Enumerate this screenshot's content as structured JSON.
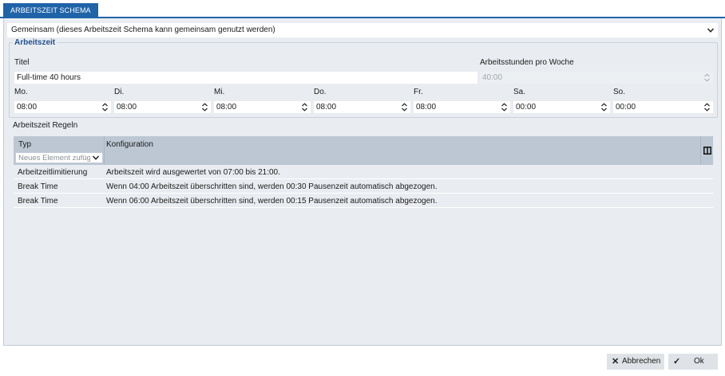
{
  "tab": {
    "label": "ARBEITSZEIT SCHEMA"
  },
  "scope_select": {
    "value": "Gemeinsam (dieses Arbeitszeit Schema kann gemeinsam genutzt werden)"
  },
  "arbeitszeit": {
    "legend": "Arbeitszeit",
    "titel_label": "Titel",
    "titel_value": "Full-time 40 hours",
    "stunden_label": "Arbeitsstunden pro Woche",
    "stunden_value": "40:00",
    "days": [
      {
        "label": "Mo.",
        "value": "08:00"
      },
      {
        "label": "Di.",
        "value": "08:00"
      },
      {
        "label": "Mi.",
        "value": "08:00"
      },
      {
        "label": "Do.",
        "value": "08:00"
      },
      {
        "label": "Fr.",
        "value": "08:00"
      },
      {
        "label": "Sa.",
        "value": "00:00"
      },
      {
        "label": "So.",
        "value": "00:00"
      }
    ]
  },
  "regeln": {
    "title": "Arbeitszeit Regeln",
    "col_typ": "Typ",
    "col_konfiguration": "Konfiguration",
    "add_placeholder": "Neues Element zufügen",
    "rows": [
      {
        "typ": "Arbeitzeitlimitierung",
        "konfiguration": "Arbeitszeit wird ausgewertet von 07:00 bis 21:00."
      },
      {
        "typ": "Break Time",
        "konfiguration": "Wenn 04:00 Arbeitszeit überschritten sind, werden 00:30 Pausenzeit automatisch abgezogen."
      },
      {
        "typ": "Break Time",
        "konfiguration": "Wenn 06:00 Arbeitszeit überschritten sind, werden 00:15 Pausenzeit automatisch abgezogen."
      }
    ]
  },
  "footer": {
    "cancel_label": "Abbrechen",
    "ok_label": "Ok"
  },
  "colors": {
    "accent": "#1f63a8",
    "panel": "#e9edf1",
    "grid_header": "#bcc7d3"
  }
}
